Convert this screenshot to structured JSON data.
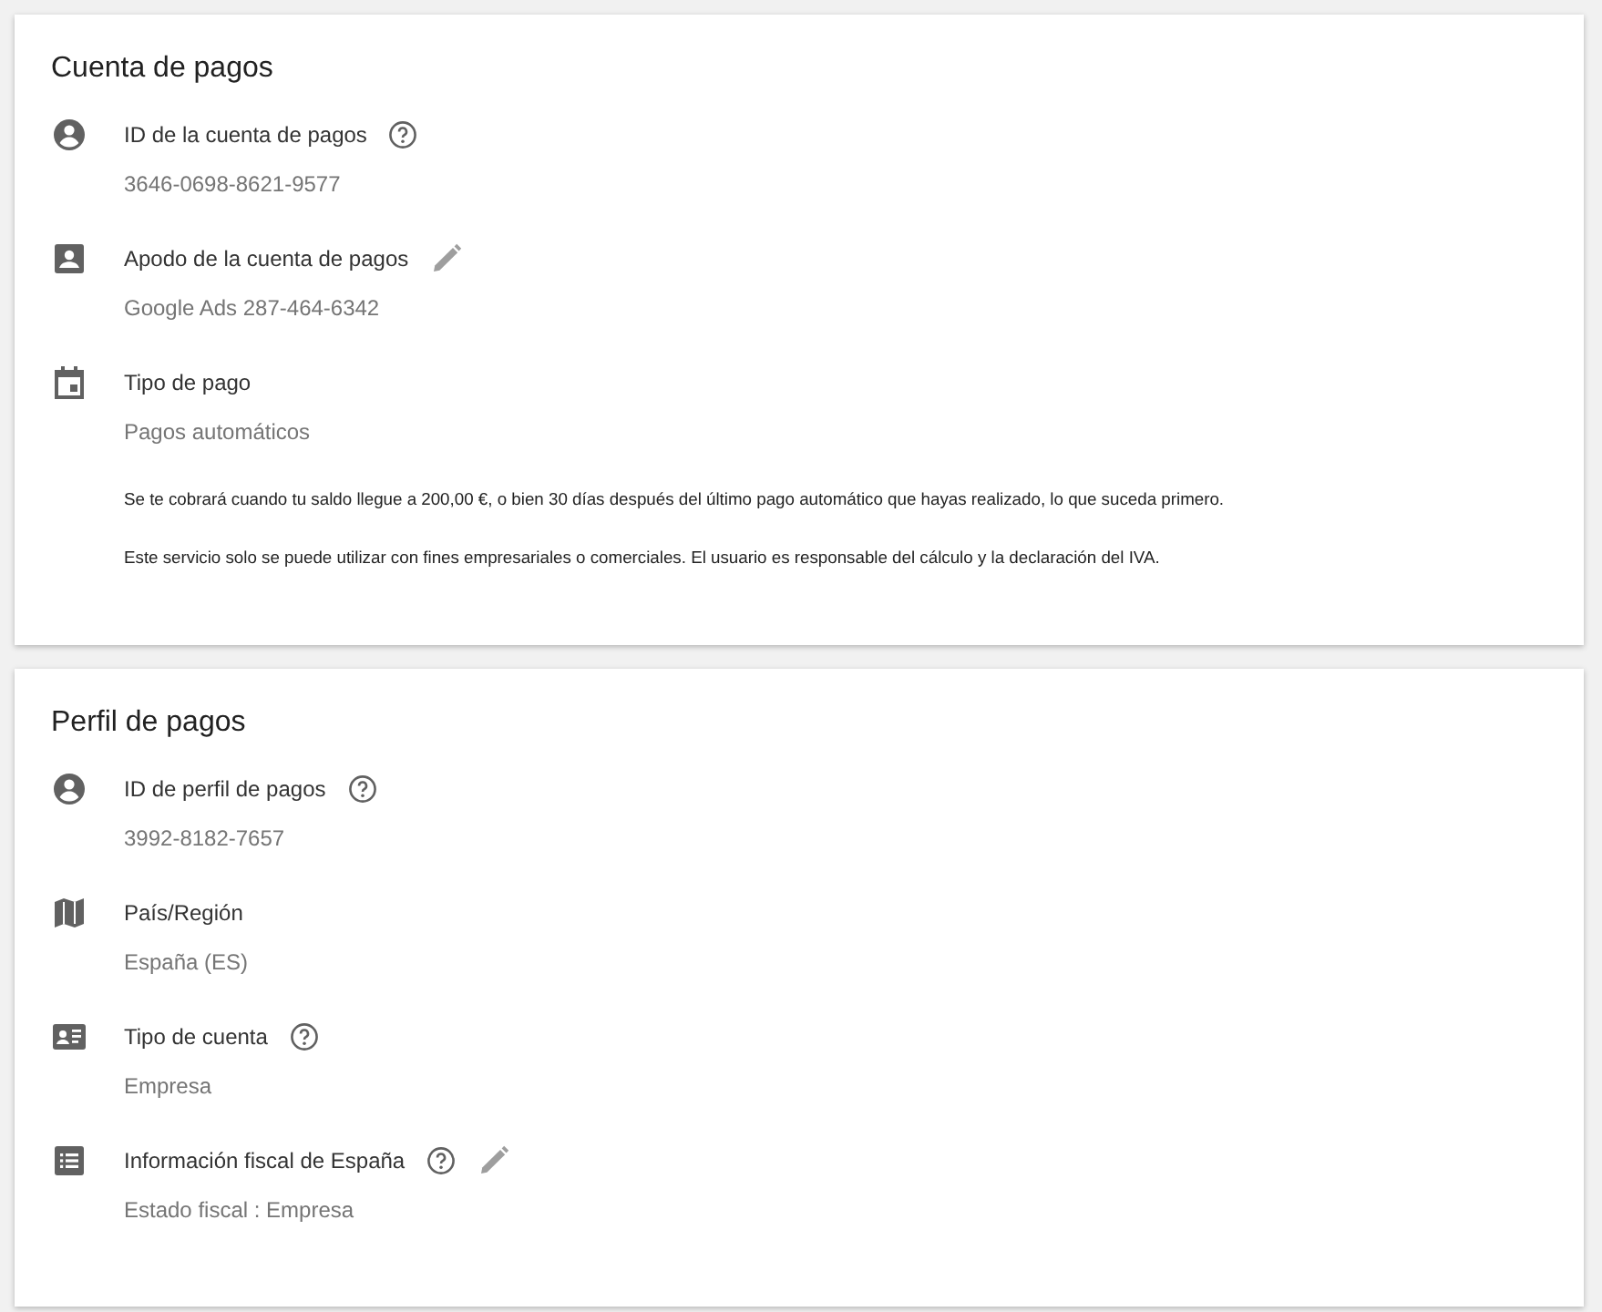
{
  "sections": [
    {
      "title": "Cuenta de pagos",
      "fields": [
        {
          "kind": "account",
          "label": "ID de la cuenta de pagos",
          "help": true,
          "editable": false,
          "value": "3646-0698-8621-9577"
        },
        {
          "kind": "contact",
          "label": "Apodo de la cuenta de pagos",
          "help": false,
          "editable": true,
          "value": "Google Ads 287-464-6342"
        },
        {
          "kind": "calendar",
          "label": "Tipo de pago",
          "help": false,
          "editable": false,
          "value": "Pagos automáticos"
        }
      ],
      "notes": [
        "Se te cobrará cuando tu saldo llegue a 200,00 €, o bien 30 días después del último pago automático que hayas realizado, lo que suceda primero.",
        "Este servicio solo se puede utilizar con fines empresariales o comerciales. El usuario es responsable del cálculo y la declaración del IVA."
      ]
    },
    {
      "title": "Perfil de pagos",
      "fields": [
        {
          "kind": "account",
          "label": "ID de perfil de pagos",
          "help": true,
          "editable": false,
          "value": "3992-8182-7657"
        },
        {
          "kind": "map",
          "label": "País/Región",
          "help": false,
          "editable": false,
          "value": "España (ES)"
        },
        {
          "kind": "idcard",
          "label": "Tipo de cuenta",
          "help": true,
          "editable": false,
          "value": "Empresa"
        },
        {
          "kind": "list",
          "label": "Información fiscal de España",
          "help": true,
          "editable": true,
          "value": "Estado fiscal : Empresa"
        }
      ]
    }
  ]
}
